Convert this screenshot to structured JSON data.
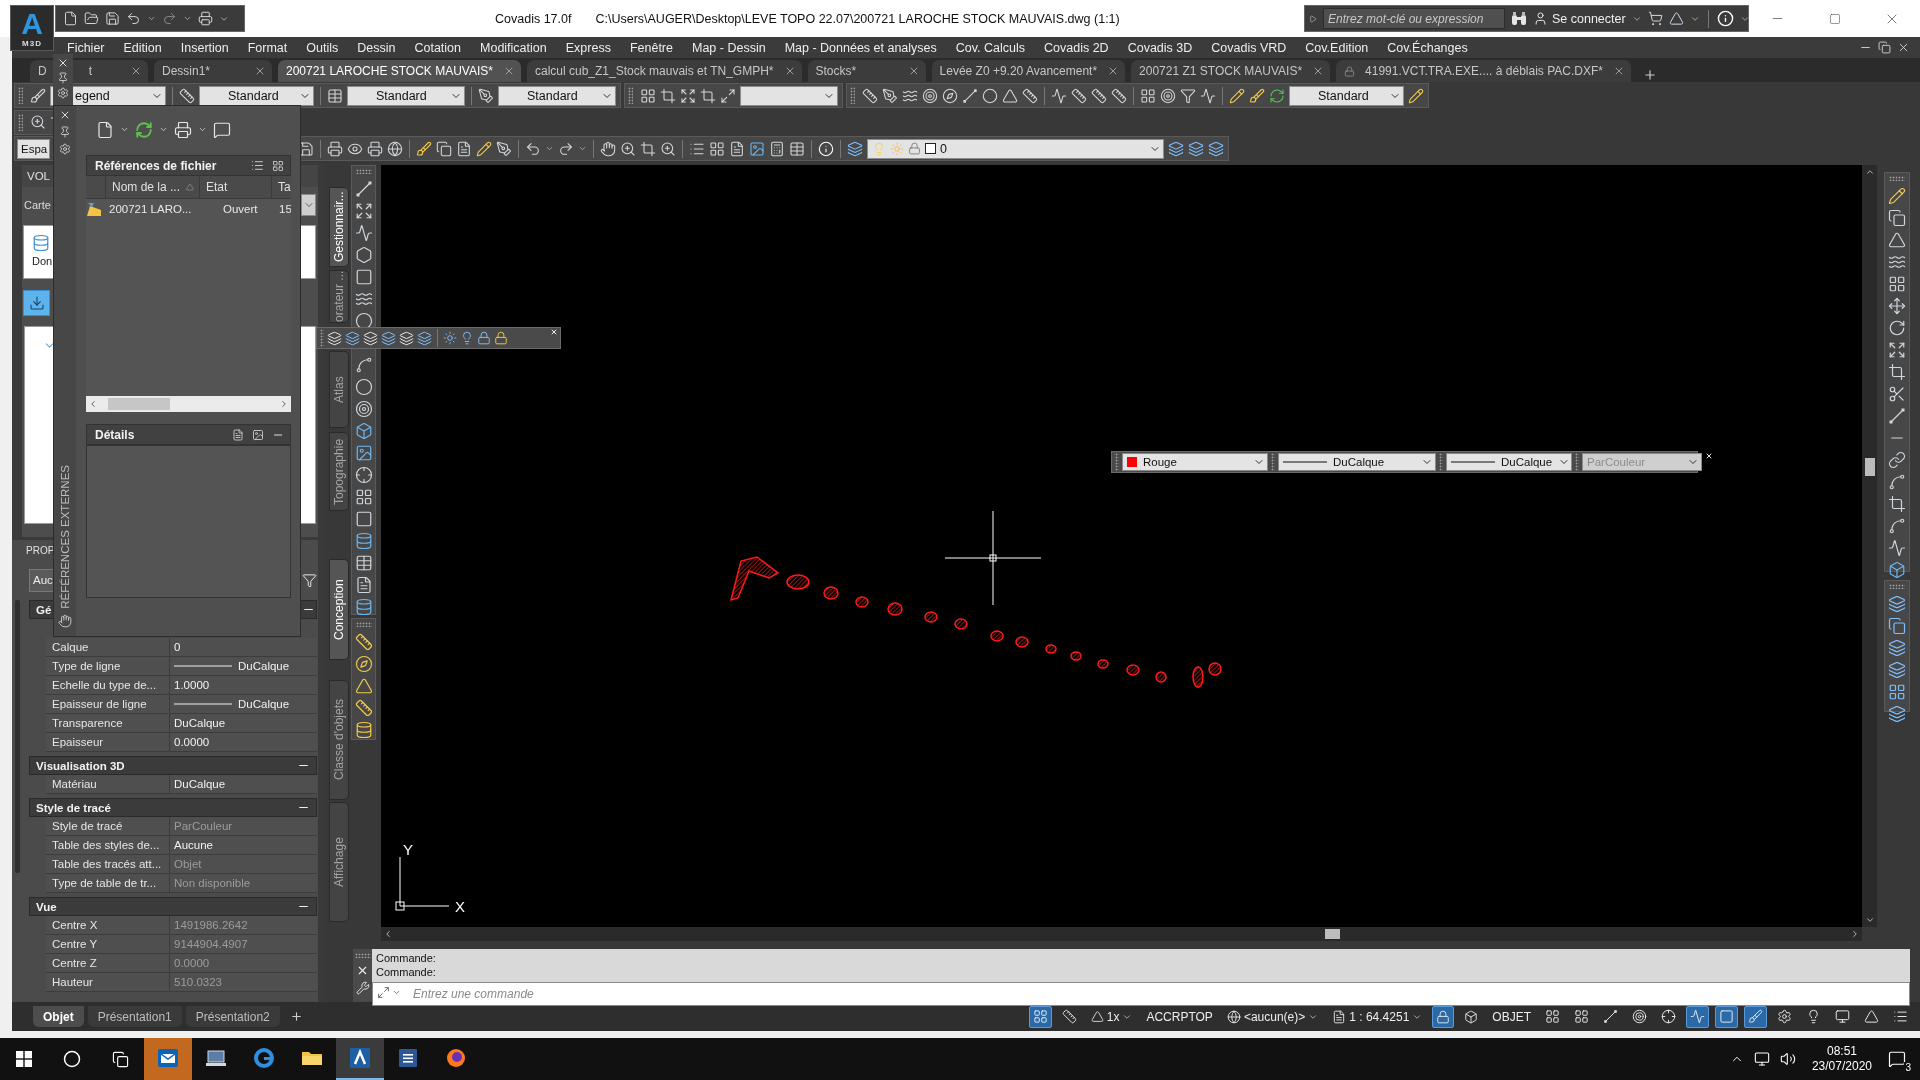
{
  "title_bar": {
    "app_letter": "A",
    "app_badge": "M3D",
    "app_name": "Covadis 17.0f",
    "document_path": "C:\\Users\\AUGER\\Desktop\\LEVE TOPO 22.07\\200721 LAROCHE STOCK MAUVAIS.dwg (1:1)",
    "search": {
      "placeholder": "Entrez mot-clé ou expression"
    },
    "sign_in": "Se connecter"
  },
  "menu_bar": [
    "Fichier",
    "Edition",
    "Insertion",
    "Format",
    "Outils",
    "Dessin",
    "Cotation",
    "Modification",
    "Express",
    "Fenêtre",
    "Map - Dessin",
    "Map - Données et analyses",
    "Cov. Calculs",
    "Covadis 2D",
    "Covadis 3D",
    "Covadis VRD",
    "Cov.Edition",
    "Cov.Échanges"
  ],
  "file_tabs": [
    {
      "label": "D",
      "label_tail": "t",
      "selected": false,
      "locked": false
    },
    {
      "label": "Dessin1*",
      "selected": false,
      "locked": false
    },
    {
      "label": "200721 LAROCHE STOCK MAUVAIS*",
      "selected": true,
      "locked": false
    },
    {
      "label": "calcul cub_Z1_Stock mauvais et TN_GMPH*",
      "selected": false,
      "locked": false
    },
    {
      "label": "Stocks*",
      "selected": false,
      "locked": false
    },
    {
      "label": "Levée Z0 +9.20 Avancement*",
      "selected": false,
      "locked": false
    },
    {
      "label": "200721 Z1 STOCK MAUVAIS*",
      "selected": false,
      "locked": false
    },
    {
      "label": "41991.VCT.TRA.EXE.... à déblais PAC.DXF*",
      "selected": false,
      "locked": true
    }
  ],
  "toolbars": {
    "text_style": "egend",
    "dimension_style": "Standard",
    "table_style": "Standard",
    "multileader_style": "Standard",
    "style": "Standard",
    "workspace": "Espa",
    "layer": "0"
  },
  "left_palette": {
    "title": "VOL",
    "map_label": "Carte",
    "item_label": "Don"
  },
  "xref_palette": {
    "title": "RÉFÉRENCES EXTERNES",
    "file_references": {
      "title": "Références de fichier",
      "columns": [
        "Nom de la ...",
        "Etat",
        "Ta"
      ],
      "rows": [
        {
          "name": "200721 LARO...",
          "status": "Ouvert",
          "size": "15"
        }
      ]
    },
    "details": {
      "title": "Détails"
    }
  },
  "properties": {
    "title": "PROP",
    "selection": "Auc",
    "sections": [
      {
        "title": "Gé",
        "expanded": true,
        "rows": [
          {
            "label": "Calque",
            "value": "0",
            "kind": "text",
            "disabled": false
          },
          {
            "label": "Type de ligne",
            "value": "DuCalque",
            "kind": "line",
            "disabled": false
          },
          {
            "label": "Echelle du type de...",
            "value": "1.0000",
            "kind": "text",
            "disabled": false
          },
          {
            "label": "Epaisseur de ligne",
            "value": "DuCalque",
            "kind": "line",
            "disabled": false
          },
          {
            "label": "Transparence",
            "value": "DuCalque",
            "kind": "text",
            "disabled": false
          },
          {
            "label": "Epaisseur",
            "value": "0.0000",
            "kind": "text",
            "disabled": false
          }
        ]
      },
      {
        "title": "Visualisation 3D",
        "expanded": true,
        "rows": [
          {
            "label": "Matériau",
            "value": "DuCalque",
            "kind": "text",
            "disabled": false
          }
        ]
      },
      {
        "title": "Style de tracé",
        "expanded": true,
        "rows": [
          {
            "label": "Style de tracé",
            "value": "ParCouleur",
            "kind": "text",
            "disabled": true
          },
          {
            "label": "Table des styles de...",
            "value": "Aucune",
            "kind": "text",
            "disabled": false
          },
          {
            "label": "Table des tracés att...",
            "value": "Objet",
            "kind": "text",
            "disabled": true
          },
          {
            "label": "Type de table de tr...",
            "value": "Non disponible",
            "kind": "text",
            "disabled": true
          }
        ]
      },
      {
        "title": "Vue",
        "expanded": true,
        "rows": [
          {
            "label": "Centre X",
            "value": "1491986.2642",
            "kind": "text",
            "disabled": true
          },
          {
            "label": "Centre Y",
            "value": "9144904.4907",
            "kind": "text",
            "disabled": true
          },
          {
            "label": "Centre Z",
            "value": "0.0000",
            "kind": "text",
            "disabled": true
          },
          {
            "label": "Hauteur",
            "value": "510.0323",
            "kind": "text",
            "disabled": true
          }
        ]
      }
    ]
  },
  "tool_palette_tabs": [
    {
      "label": "Gestionnair...",
      "selected": true
    },
    {
      "label": "orateur ...",
      "selected": false
    },
    {
      "label": "Atlas",
      "selected": false
    },
    {
      "label": "Topographie",
      "selected": false
    },
    {
      "label": "Conception",
      "selected": true
    },
    {
      "label": "Classe d'objets",
      "selected": false
    },
    {
      "label": "Affichage",
      "selected": false
    }
  ],
  "properties_toolbar": {
    "color_dropdown": "Rouge",
    "linetype": "DuCalque",
    "lineweight": "DuCalque",
    "plot_style": {
      "label": "ParCouleur",
      "disabled": true
    }
  },
  "drawing": {
    "ucs": {
      "x_label": "X",
      "y_label": "Y"
    }
  },
  "command_line": {
    "history": [
      "Commande:",
      "Commande:"
    ],
    "placeholder": "Entrez une commande"
  },
  "layout_tabs": [
    {
      "label": "Objet",
      "selected": true
    },
    {
      "label": "Présentation1",
      "selected": false
    },
    {
      "label": "Présentation2",
      "selected": false
    }
  ],
  "status_bar": {
    "toggles_a": [
      {
        "on": true
      },
      {
        "on": false
      }
    ],
    "annotation_scale": "1x",
    "osnap_mode": "ACCRPTOP",
    "ucs": "<aucun(e)>",
    "viewport_scale": "1 : 64.4251",
    "toggles_b": [
      {
        "on": true
      },
      {
        "on": false
      }
    ],
    "space": "OBJET",
    "toggles_c": [
      {
        "on": false
      },
      {
        "on": false
      },
      {
        "on": false
      },
      {
        "on": false
      },
      {
        "on": false
      },
      {
        "on": true
      },
      {
        "on": true
      },
      {
        "on": true
      },
      {
        "on": false
      },
      {
        "on": false
      },
      {
        "on": false
      },
      {
        "on": false
      },
      {
        "on": false
      }
    ]
  },
  "taskbar": {
    "apps": [
      {
        "kind": "outlook",
        "selected": false,
        "attention": true
      },
      {
        "kind": "laptop",
        "selected": false,
        "attention": false
      },
      {
        "kind": "edge",
        "selected": false,
        "attention": false
      },
      {
        "kind": "explorer",
        "selected": false,
        "attention": false
      },
      {
        "kind": "autocad",
        "selected": true,
        "attention": false
      },
      {
        "kind": "word",
        "selected": false,
        "attention": false
      },
      {
        "kind": "firefox",
        "selected": false,
        "attention": false
      }
    ],
    "time": "08:51",
    "date": "23/07/2020",
    "notifications": "3"
  }
}
